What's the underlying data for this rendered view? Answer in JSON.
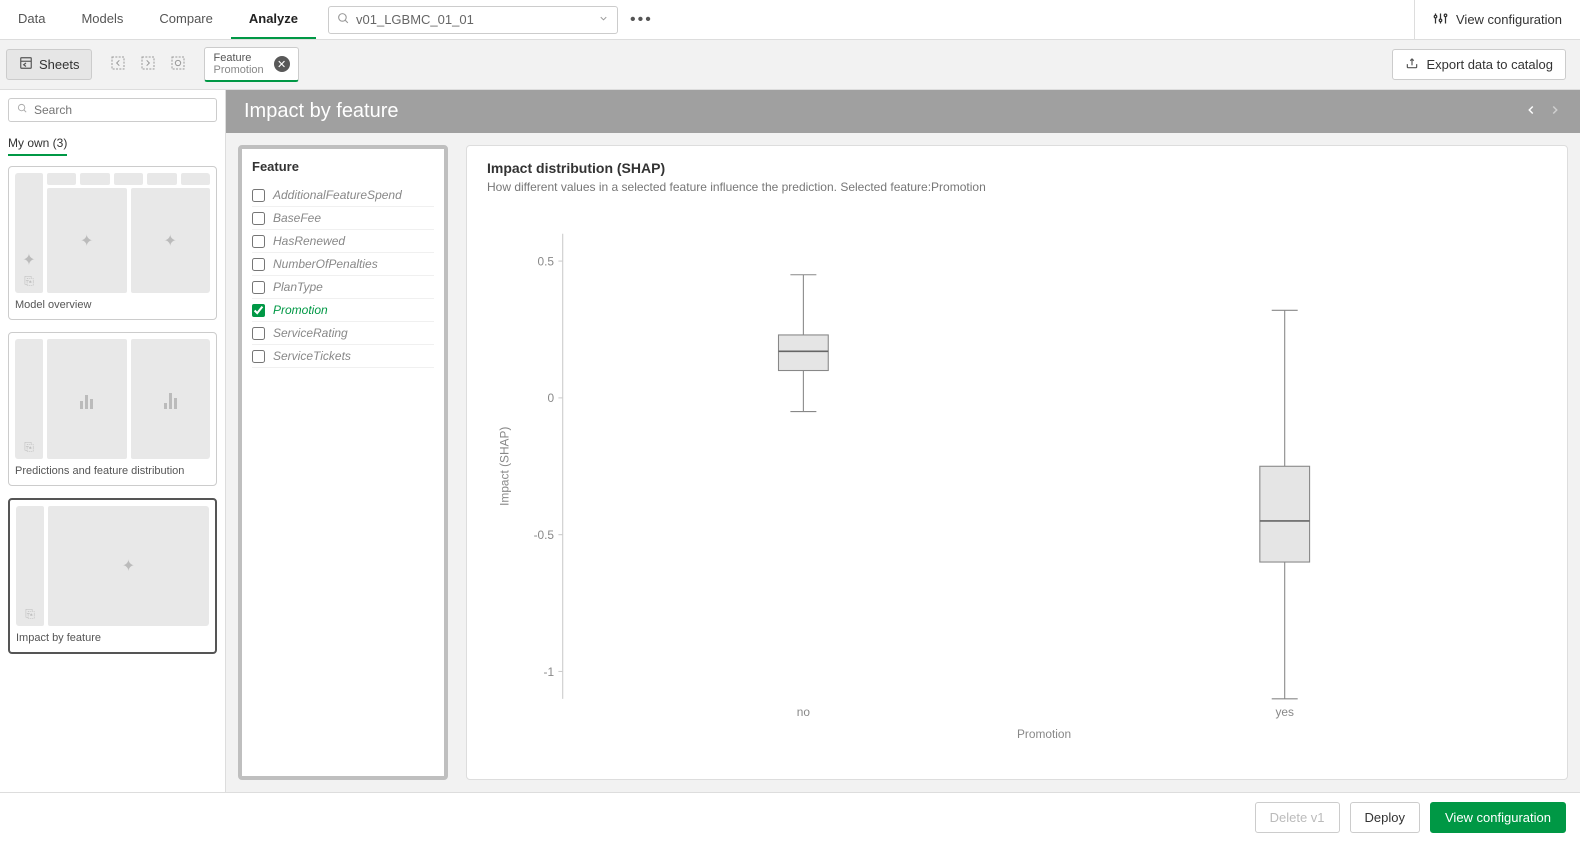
{
  "nav": {
    "tabs": [
      "Data",
      "Models",
      "Compare",
      "Analyze"
    ],
    "active": 3
  },
  "model_selector": {
    "value": "v01_LGBMC_01_01"
  },
  "view_config_label": "View configuration",
  "sheets_label": "Sheets",
  "feature_tab": {
    "title": "Feature",
    "sub": "Promotion"
  },
  "export_label": "Export data to catalog",
  "search_placeholder": "Search",
  "my_own_label": "My own (3)",
  "thumbnails": [
    {
      "label": "Model overview"
    },
    {
      "label": "Predictions and feature distribution"
    },
    {
      "label": "Impact by feature"
    }
  ],
  "banner_title": "Impact by feature",
  "feature_panel_title": "Feature",
  "features": [
    {
      "name": "AdditionalFeatureSpend",
      "checked": false
    },
    {
      "name": "BaseFee",
      "checked": false
    },
    {
      "name": "HasRenewed",
      "checked": false
    },
    {
      "name": "NumberOfPenalties",
      "checked": false
    },
    {
      "name": "PlanType",
      "checked": false
    },
    {
      "name": "Promotion",
      "checked": true
    },
    {
      "name": "ServiceRating",
      "checked": false
    },
    {
      "name": "ServiceTickets",
      "checked": false
    }
  ],
  "chart": {
    "title": "Impact distribution (SHAP)",
    "subtitle": "How different values in a selected feature influence the prediction. Selected feature:Promotion"
  },
  "chart_data": {
    "type": "boxplot",
    "xlabel": "Promotion",
    "ylabel": "Impact (SHAP)",
    "ylim": [
      -1.1,
      0.6
    ],
    "yticks": [
      -1,
      -0.5,
      0,
      0.5
    ],
    "categories": [
      "no",
      "yes"
    ],
    "boxes": [
      {
        "category": "no",
        "whisker_low": -0.05,
        "q1": 0.1,
        "median": 0.17,
        "q3": 0.23,
        "whisker_high": 0.45
      },
      {
        "category": "yes",
        "whisker_low": -1.1,
        "q1": -0.6,
        "median": -0.45,
        "q3": -0.25,
        "whisker_high": 0.32
      }
    ]
  },
  "footer": {
    "delete": "Delete v1",
    "deploy": "Deploy",
    "view": "View configuration"
  }
}
